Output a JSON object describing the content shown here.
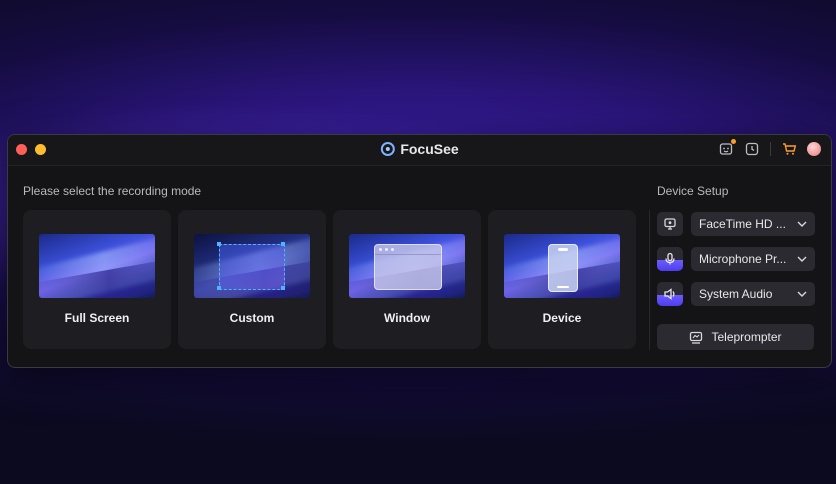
{
  "window": {
    "title": "FocuSee",
    "logo_icon": "focusee-logo-icon",
    "toolbar_icons": [
      "feedback-icon",
      "history-clock-icon",
      "cart-icon",
      "avatar"
    ],
    "accent_color": "#4fb4ff",
    "traffic_colors": [
      "#ff5f57",
      "#febc2e"
    ]
  },
  "recording": {
    "prompt": "Please select the recording mode",
    "modes": [
      {
        "label": "Full Screen"
      },
      {
        "label": "Custom"
      },
      {
        "label": "Window"
      },
      {
        "label": "Device"
      }
    ]
  },
  "device_setup": {
    "title": "Device Setup",
    "camera": {
      "value": "FaceTime HD ...",
      "icon": "webcam-icon"
    },
    "microphone": {
      "value": "Microphone Pr...",
      "icon": "microphone-icon",
      "level": 0.45
    },
    "audio": {
      "value": "System Audio",
      "icon": "speaker-icon",
      "level": 0.45
    },
    "teleprompter_label": "Teleprompter",
    "teleprompter_icon": "teleprompter-icon"
  }
}
